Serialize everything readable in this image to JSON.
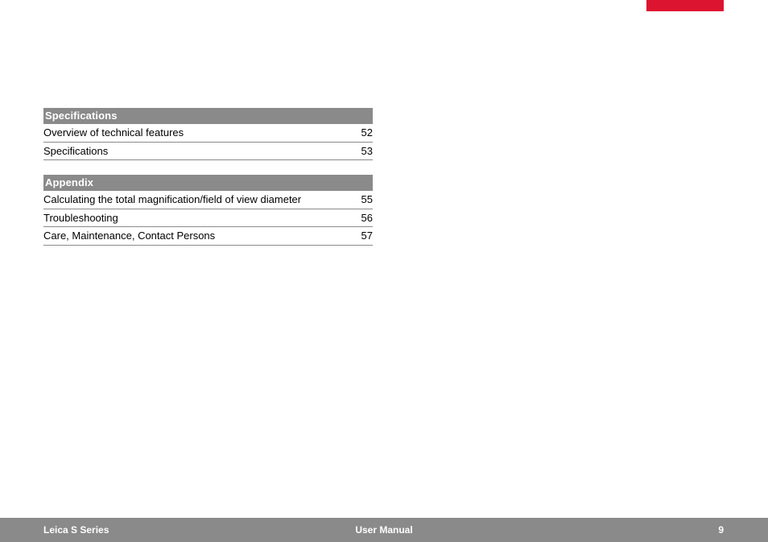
{
  "sections": [
    {
      "title": "Specifications",
      "rows": [
        {
          "label": "Overview of technical features",
          "page": "52"
        },
        {
          "label": "Specifications",
          "page": "53"
        }
      ]
    },
    {
      "title": "Appendix",
      "rows": [
        {
          "label": "Calculating the total magnification/field of view diameter",
          "page": "55"
        },
        {
          "label": "Troubleshooting",
          "page": "56"
        },
        {
          "label": "Care, Maintenance, Contact Persons",
          "page": "57"
        }
      ]
    }
  ],
  "footer": {
    "left": "Leica S Series",
    "center": "User Manual",
    "right": "9"
  }
}
